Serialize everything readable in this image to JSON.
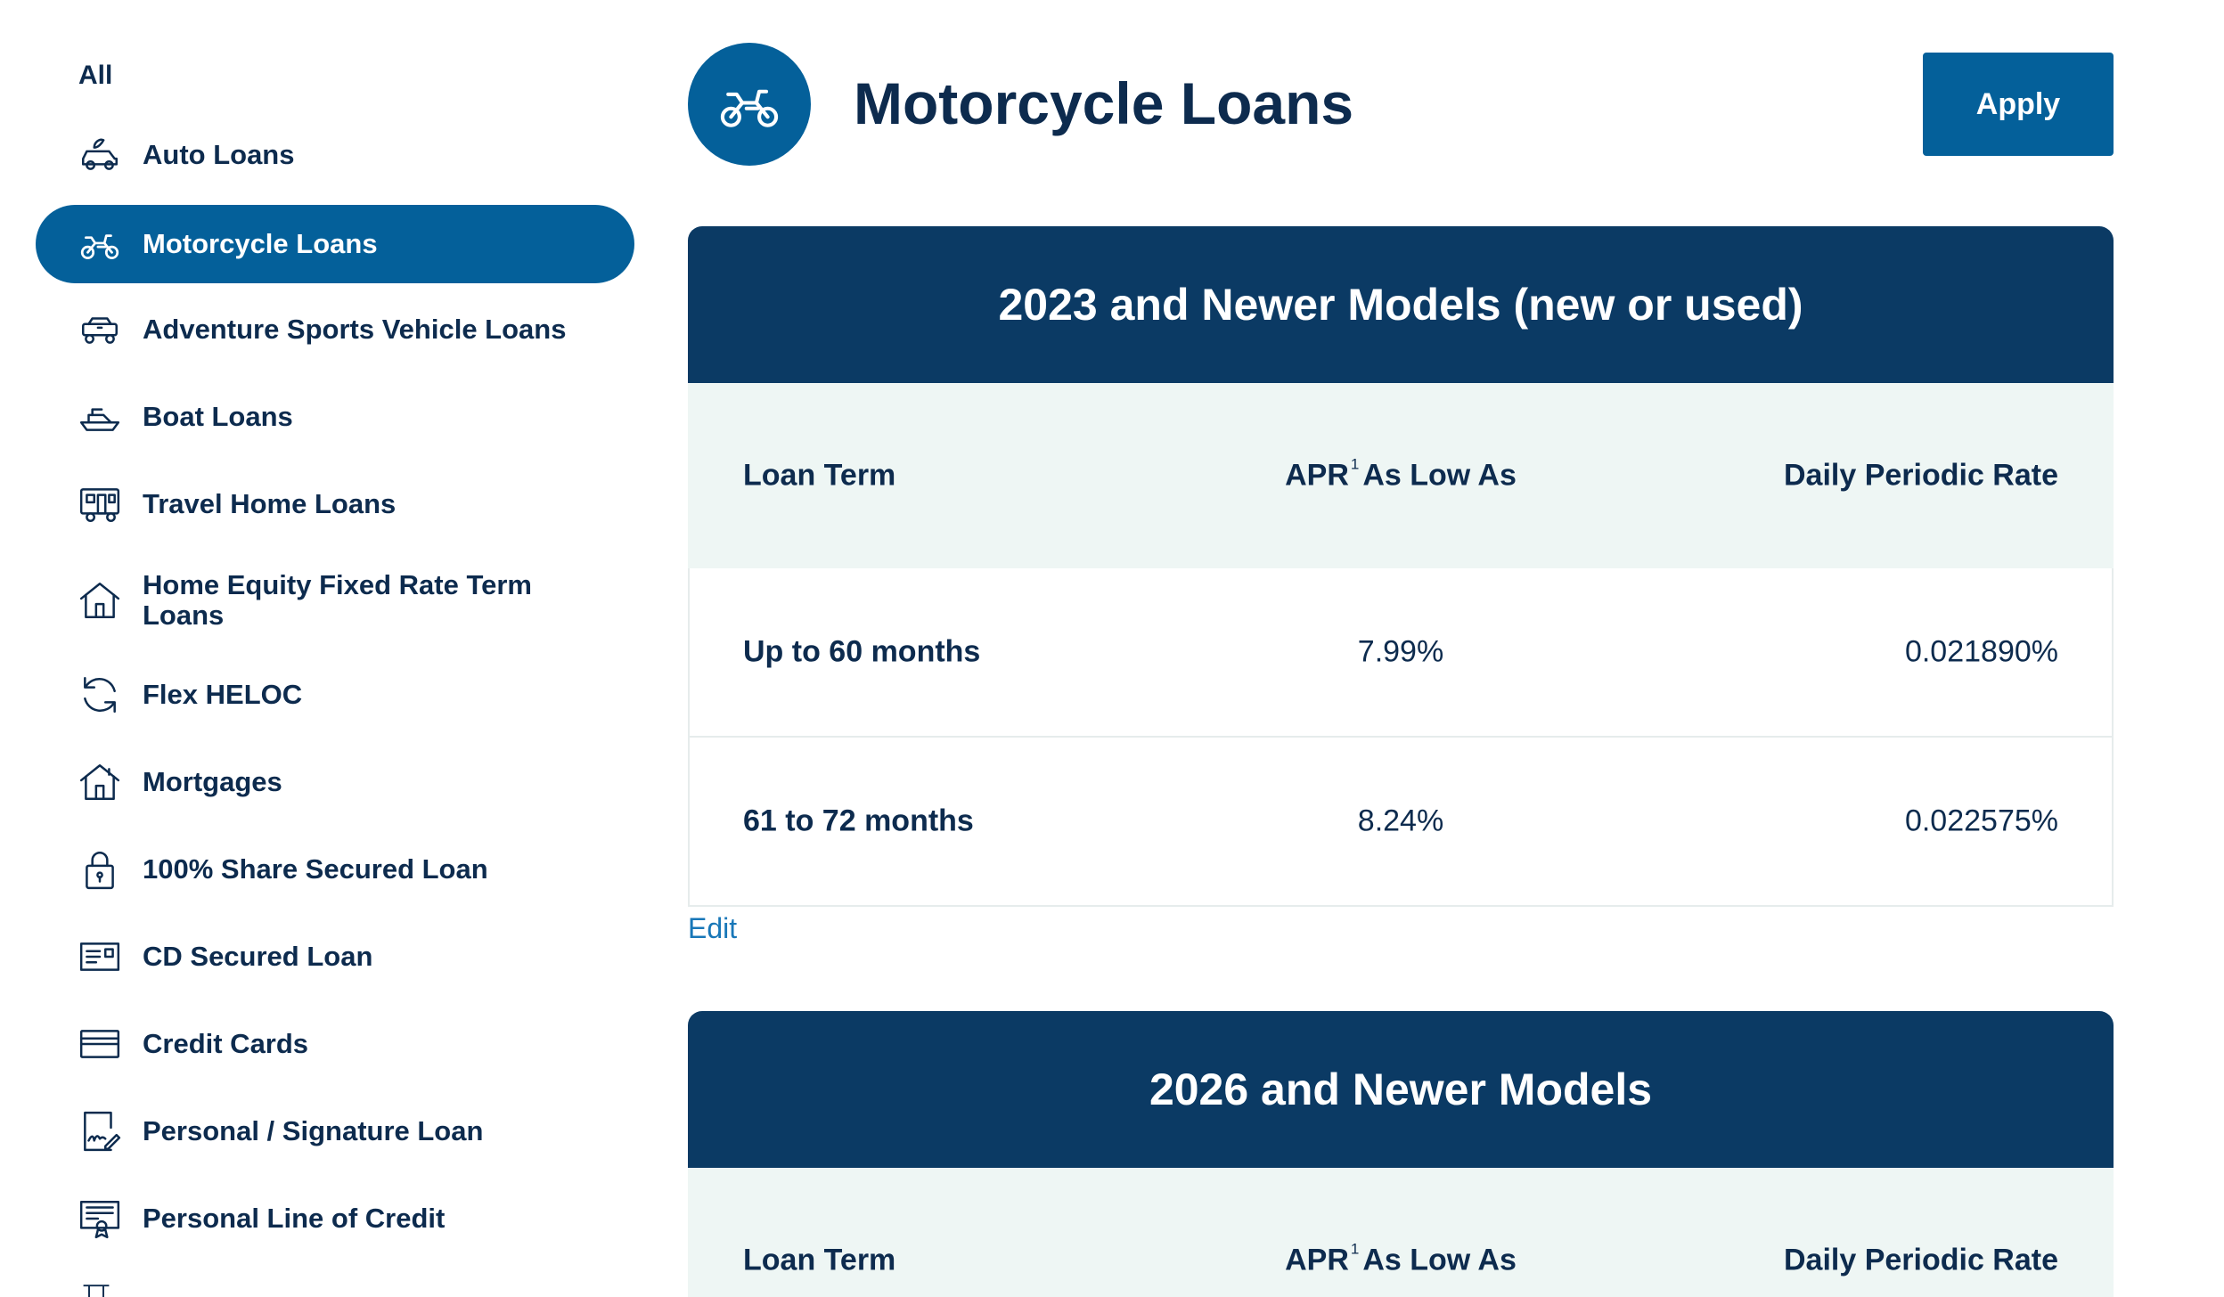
{
  "sidebar": {
    "all_label": "All",
    "items": [
      {
        "label": "Auto Loans",
        "icon": "car-icon"
      },
      {
        "label": "Motorcycle Loans",
        "icon": "motorcycle-icon",
        "active": true
      },
      {
        "label": "Adventure Sports Vehicle Loans",
        "icon": "atv-icon"
      },
      {
        "label": "Boat Loans",
        "icon": "boat-icon"
      },
      {
        "label": "Travel Home Loans",
        "icon": "rv-icon"
      },
      {
        "label": "Home Equity Fixed Rate Term Loans",
        "icon": "house-icon"
      },
      {
        "label": "Flex HELOC",
        "icon": "refresh-icon"
      },
      {
        "label": "Mortgages",
        "icon": "home-icon"
      },
      {
        "label": "100% Share Secured Loan",
        "icon": "lock-icon"
      },
      {
        "label": "CD Secured Loan",
        "icon": "certificate-icon"
      },
      {
        "label": "Credit Cards",
        "icon": "credit-card-icon"
      },
      {
        "label": "Personal / Signature Loan",
        "icon": "signature-icon"
      },
      {
        "label": "Personal Line of Credit",
        "icon": "award-document-icon"
      }
    ]
  },
  "header": {
    "title": "Motorcycle Loans",
    "apply_label": "Apply",
    "icon": "motorcycle-icon"
  },
  "tables": [
    {
      "title": "2023 and Newer Models (new or used)",
      "columns": {
        "term": "Loan Term",
        "apr": "APR",
        "apr_sup": "1",
        "apr_suffix": "As Low As",
        "dpr": "Daily Periodic Rate"
      },
      "rows": [
        {
          "term": "Up to 60 months",
          "apr": "7.99%",
          "dpr": "0.021890%"
        },
        {
          "term": "61 to 72 months",
          "apr": "8.24%",
          "dpr": "0.022575%"
        }
      ]
    },
    {
      "title": "2026 and Newer Models",
      "columns": {
        "term": "Loan Term",
        "apr": "APR",
        "apr_sup": "1",
        "apr_suffix": "As Low As",
        "dpr": "Daily Periodic Rate"
      },
      "rows": []
    }
  ],
  "edit_label": "Edit",
  "colors": {
    "primary": "#04609a",
    "navy": "#0b3a64",
    "text": "#0d2b4e",
    "header_bg": "#eef6f4",
    "link": "#1877b8"
  }
}
